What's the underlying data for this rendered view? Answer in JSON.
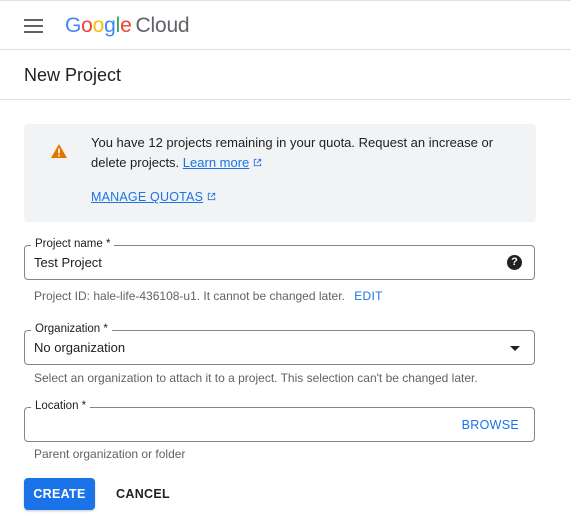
{
  "header": {
    "logo": {
      "g1": "G",
      "o1": "o",
      "o2": "o",
      "g2": "g",
      "l": "l",
      "e": "e",
      "product": "Cloud"
    },
    "menu_icon": "hamburger-menu-icon"
  },
  "page": {
    "title": "New Project"
  },
  "quota": {
    "message": "You have 12 projects remaining in your quota. Request an increase or delete projects.",
    "learn_more": "Learn more",
    "manage_quotas": "MANAGE QUOTAS",
    "icon": "warning-icon",
    "warning_color": "#e37400"
  },
  "project_name": {
    "label": "Project name *",
    "value": "Test Project",
    "project_id_prefix": "Project ID:",
    "project_id": "hale-life-436108-u1",
    "project_id_suffix": ". It cannot be changed later.",
    "edit_label": "EDIT"
  },
  "organization": {
    "label": "Organization *",
    "selected": "No organization",
    "hint": "Select an organization to attach it to a project. This selection can't be changed later."
  },
  "location": {
    "label": "Location *",
    "value": "",
    "browse_label": "BROWSE",
    "hint": "Parent organization or folder"
  },
  "actions": {
    "create_label": "CREATE",
    "cancel_label": "CANCEL"
  },
  "colors": {
    "primary": "#1a73e8",
    "google_blue": "#4285F4",
    "google_red": "#EA4335",
    "google_yellow": "#FBBC05",
    "google_green": "#34A853"
  }
}
